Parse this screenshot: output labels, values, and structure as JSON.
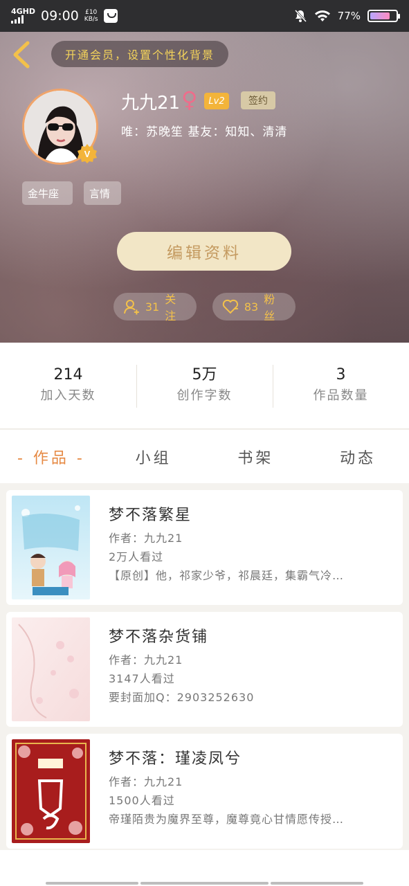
{
  "status_bar": {
    "network": "4GHD",
    "time": "09:00",
    "speed_value": "£10",
    "speed_unit": "KB/s",
    "battery": "77%"
  },
  "header": {
    "vip_banner": "开通会员，设置个性化背景"
  },
  "profile": {
    "name": "九九21",
    "level": "Lv2",
    "sign_badge": "签约",
    "bio": "唯：苏晚笙  基友：知知、清清",
    "avatar_badge": "V",
    "tags": [
      "金牛座",
      "言情"
    ],
    "edit_button": "编辑资料",
    "follow_count": "31",
    "follow_label": "关注",
    "fans_count": "83",
    "fans_label": "粉丝"
  },
  "stats": [
    {
      "value": "214",
      "label": "加入天数"
    },
    {
      "value": "5万",
      "label": "创作字数"
    },
    {
      "value": "3",
      "label": "作品数量"
    }
  ],
  "tabs": [
    "- 作品 -",
    "小组",
    "书架",
    "动态"
  ],
  "works": [
    {
      "title": "梦不落繁星",
      "author": "作者：九九21",
      "views": "2万人看过",
      "desc": "【原创】他，祁家少爷，祁晨廷，集霸气冷…"
    },
    {
      "title": "梦不落杂货铺",
      "author": "作者：九九21",
      "views": "3147人看过",
      "desc": "要封面加Q：2903252630"
    },
    {
      "title": "梦不落：瑾凌凤兮",
      "author": "作者：九九21",
      "views": "1500人看过",
      "desc": "帝瑾陌贵为魔界至尊，魔尊竟心甘情愿传授…"
    }
  ],
  "colors": {
    "accent": "#e68a44",
    "gold": "#f3c14a",
    "edit_button_bg": "#f2e6c6"
  }
}
